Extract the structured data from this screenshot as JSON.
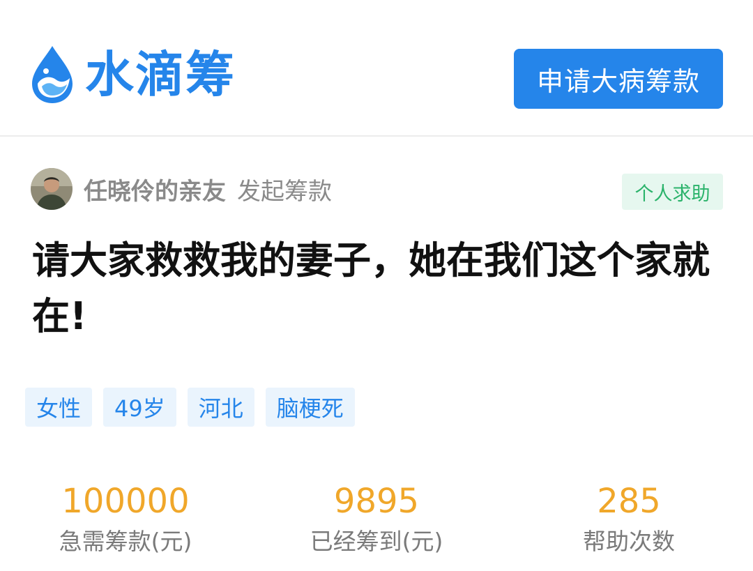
{
  "header": {
    "logo_text": "水滴筹",
    "apply_button_label": "申请大病筹款"
  },
  "organizer": {
    "name": "任晓伶的亲友",
    "action": "发起筹款",
    "badge": "个人求助"
  },
  "campaign": {
    "title": "请大家救救我的妻子，她在我们这个家就在!",
    "tags": [
      "女性",
      "49岁",
      "河北",
      "脑梗死"
    ]
  },
  "stats": [
    {
      "value": "100000",
      "label": "急需筹款(元)"
    },
    {
      "value": "9895",
      "label": "已经筹到(元)"
    },
    {
      "value": "285",
      "label": "帮助次数"
    }
  ],
  "colors": {
    "brand_blue": "#2585ea",
    "stat_orange": "#f0a72a",
    "badge_green": "#2bb36b"
  },
  "icons": {
    "logo": "water-drop-icon",
    "avatar": "user-avatar"
  }
}
